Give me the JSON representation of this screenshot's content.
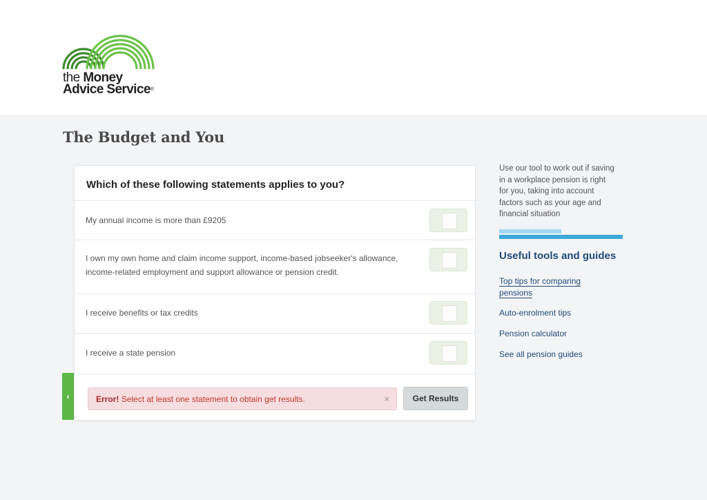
{
  "brand": {
    "logo_line1_a": "the",
    "logo_line1_b": "Money",
    "logo_line2": "Advice Service",
    "registered_mark": "®",
    "accent_green": "#5cb746"
  },
  "page": {
    "title": "The Budget and You"
  },
  "form": {
    "question": "Which of these following statements applies to you?",
    "statements": [
      {
        "label": "My annual income is more than £9205",
        "checked": false
      },
      {
        "label": "I own my own home and claim income support, income-based jobseeker's allowance, income-related employment and support allowance or pension credit.",
        "checked": false
      },
      {
        "label": "I receive benefits or tax credits",
        "checked": false
      },
      {
        "label": "I receive a state pension",
        "checked": false
      }
    ],
    "error_prefix": "Error!",
    "error_message": "Select at least one statement to obtain get results.",
    "error_close_icon": "×",
    "submit_label": "Get Results",
    "back_icon": "‹"
  },
  "sidebar": {
    "intro": "Use our tool to work out if saving in a workplace pension is right for you, taking into account factors such as your age and financial situation",
    "progress_fraction": 0.5,
    "tools_heading": "Useful tools and guides",
    "links": [
      "Top tips for comparing pensions",
      "Auto-enrolment tips",
      "Pension calculator",
      "See all pension guides"
    ],
    "link_color": "#1f4b7a"
  }
}
